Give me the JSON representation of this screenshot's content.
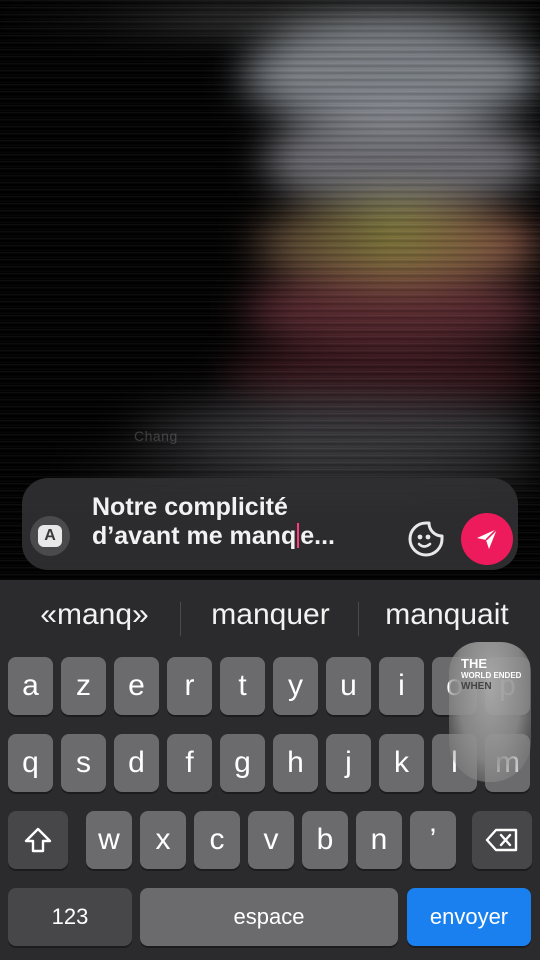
{
  "background": {
    "faint_label": "Chang"
  },
  "composer": {
    "message_line1": "Notre complicité",
    "message_line2_before_cursor": "d’avant me manq",
    "message_line2_after_cursor": "e...",
    "keyboard_switch_label": "A",
    "send_color": "#ee1b5c"
  },
  "keyboard": {
    "suggestions": [
      "«manq»",
      "manquer",
      "manquait"
    ],
    "row1": [
      "a",
      "z",
      "e",
      "r",
      "t",
      "y",
      "u",
      "i",
      "o",
      "p"
    ],
    "row2": [
      "q",
      "s",
      "d",
      "f",
      "g",
      "h",
      "j",
      "k",
      "l",
      "m"
    ],
    "row3": [
      "w",
      "x",
      "c",
      "v",
      "b",
      "n",
      "’"
    ],
    "numbers_label": "123",
    "space_label": "espace",
    "return_label": "envoyer",
    "return_color": "#1a80f0"
  },
  "watermark": {
    "line1": "THE",
    "line2": "WORLD ENDED",
    "line3": "WHEN"
  }
}
